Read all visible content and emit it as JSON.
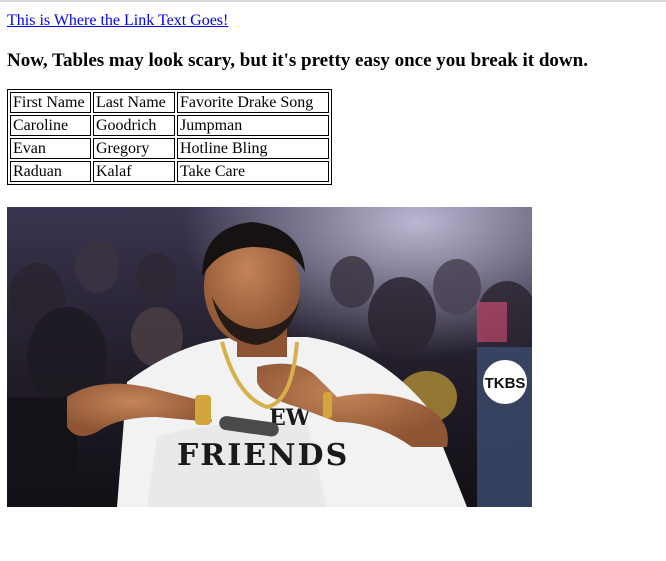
{
  "link": {
    "text": "This is Where the Link Text Goes!"
  },
  "heading": "Now, Tables may look scary, but it's pretty easy once you break it down.",
  "table": {
    "headers": [
      "First Name",
      "Last Name",
      "Favorite Drake Song"
    ],
    "rows": [
      [
        "Caroline",
        "Goodrich",
        "Jumpman"
      ],
      [
        "Evan",
        "Gregory",
        "Hotline Bling"
      ],
      [
        "Raduan",
        "Kalaf",
        "Take Care"
      ]
    ]
  },
  "photo": {
    "shirt_text_top": "EW",
    "shirt_text_bottom": "FRIENDS",
    "badge_text": "TKBS",
    "colors": {
      "background": "#1c1a24",
      "skin": "#a86a45",
      "shirt": "#f2f2f2",
      "link": "#0000ee"
    }
  }
}
